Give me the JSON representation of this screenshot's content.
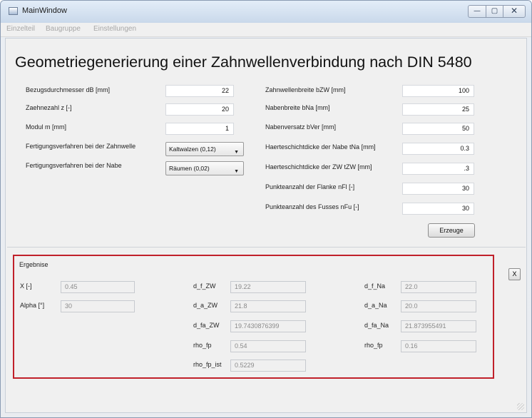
{
  "window": {
    "title": "MainWindow",
    "controls": {
      "minimize": "—",
      "maximize": "▢",
      "close": "✕"
    }
  },
  "menu": [
    "Einzelteil",
    "Baugruppe",
    "Einstellungen"
  ],
  "heading": "Geometriegenerierung einer Zahnwellenverbindung nach DIN 5480",
  "left_inputs": [
    {
      "label": "Bezugsdurchmesser dB [mm]",
      "value": "22"
    },
    {
      "label": "Zaehnezahl z [-]",
      "value": "20"
    },
    {
      "label": "Modul m [mm]",
      "value": "1"
    }
  ],
  "left_selects": [
    {
      "label": "Fertigungsverfahren bei der Zahnwelle",
      "value": "Kaltwalzen (0,12)"
    },
    {
      "label": "Fertigungsverfahren bei der Nabe",
      "value": "Räumen (0,02)"
    }
  ],
  "right_inputs": [
    {
      "label": "Zahnwellenbreite bZW [mm]",
      "value": "100"
    },
    {
      "label": "Nabenbreite bNa [mm]",
      "value": "25"
    },
    {
      "label": "Nabenversatz bVer [mm]",
      "value": "50"
    },
    {
      "label": "Haerteschichtdicke der Nabe tNa [mm]",
      "value": "0.3"
    },
    {
      "label": "Haerteschichtdicke der ZW tZW [mm]",
      "value": ".3"
    },
    {
      "label": "Punkteanzahl der Flanke nFl [-]",
      "value": "30"
    },
    {
      "label": "Punkteanzahl des Fusses nFu [-]",
      "value": "30"
    }
  ],
  "generate_button": "Erzeuge",
  "results": {
    "title": "Ergebnise",
    "col1": [
      {
        "label": "X [-]",
        "value": "0.45"
      },
      {
        "label": "Alpha [°]",
        "value": "30"
      }
    ],
    "col2": [
      {
        "label": "d_f_ZW",
        "value": "19.22"
      },
      {
        "label": "d_a_ZW",
        "value": "21.8"
      },
      {
        "label": "d_fa_ZW",
        "value": "19.7430876399"
      },
      {
        "label": "rho_fp",
        "value": "0.54"
      },
      {
        "label": "rho_fp_ist",
        "value": "0.5229"
      }
    ],
    "col3": [
      {
        "label": "d_f_Na",
        "value": "22.0"
      },
      {
        "label": "d_a_Na",
        "value": "20.0"
      },
      {
        "label": "d_fa_Na",
        "value": "21.873955491"
      },
      {
        "label": "rho_fp",
        "value": "0.16"
      }
    ],
    "close_button": "X"
  },
  "colors": {
    "results_border": "#c0202a"
  }
}
